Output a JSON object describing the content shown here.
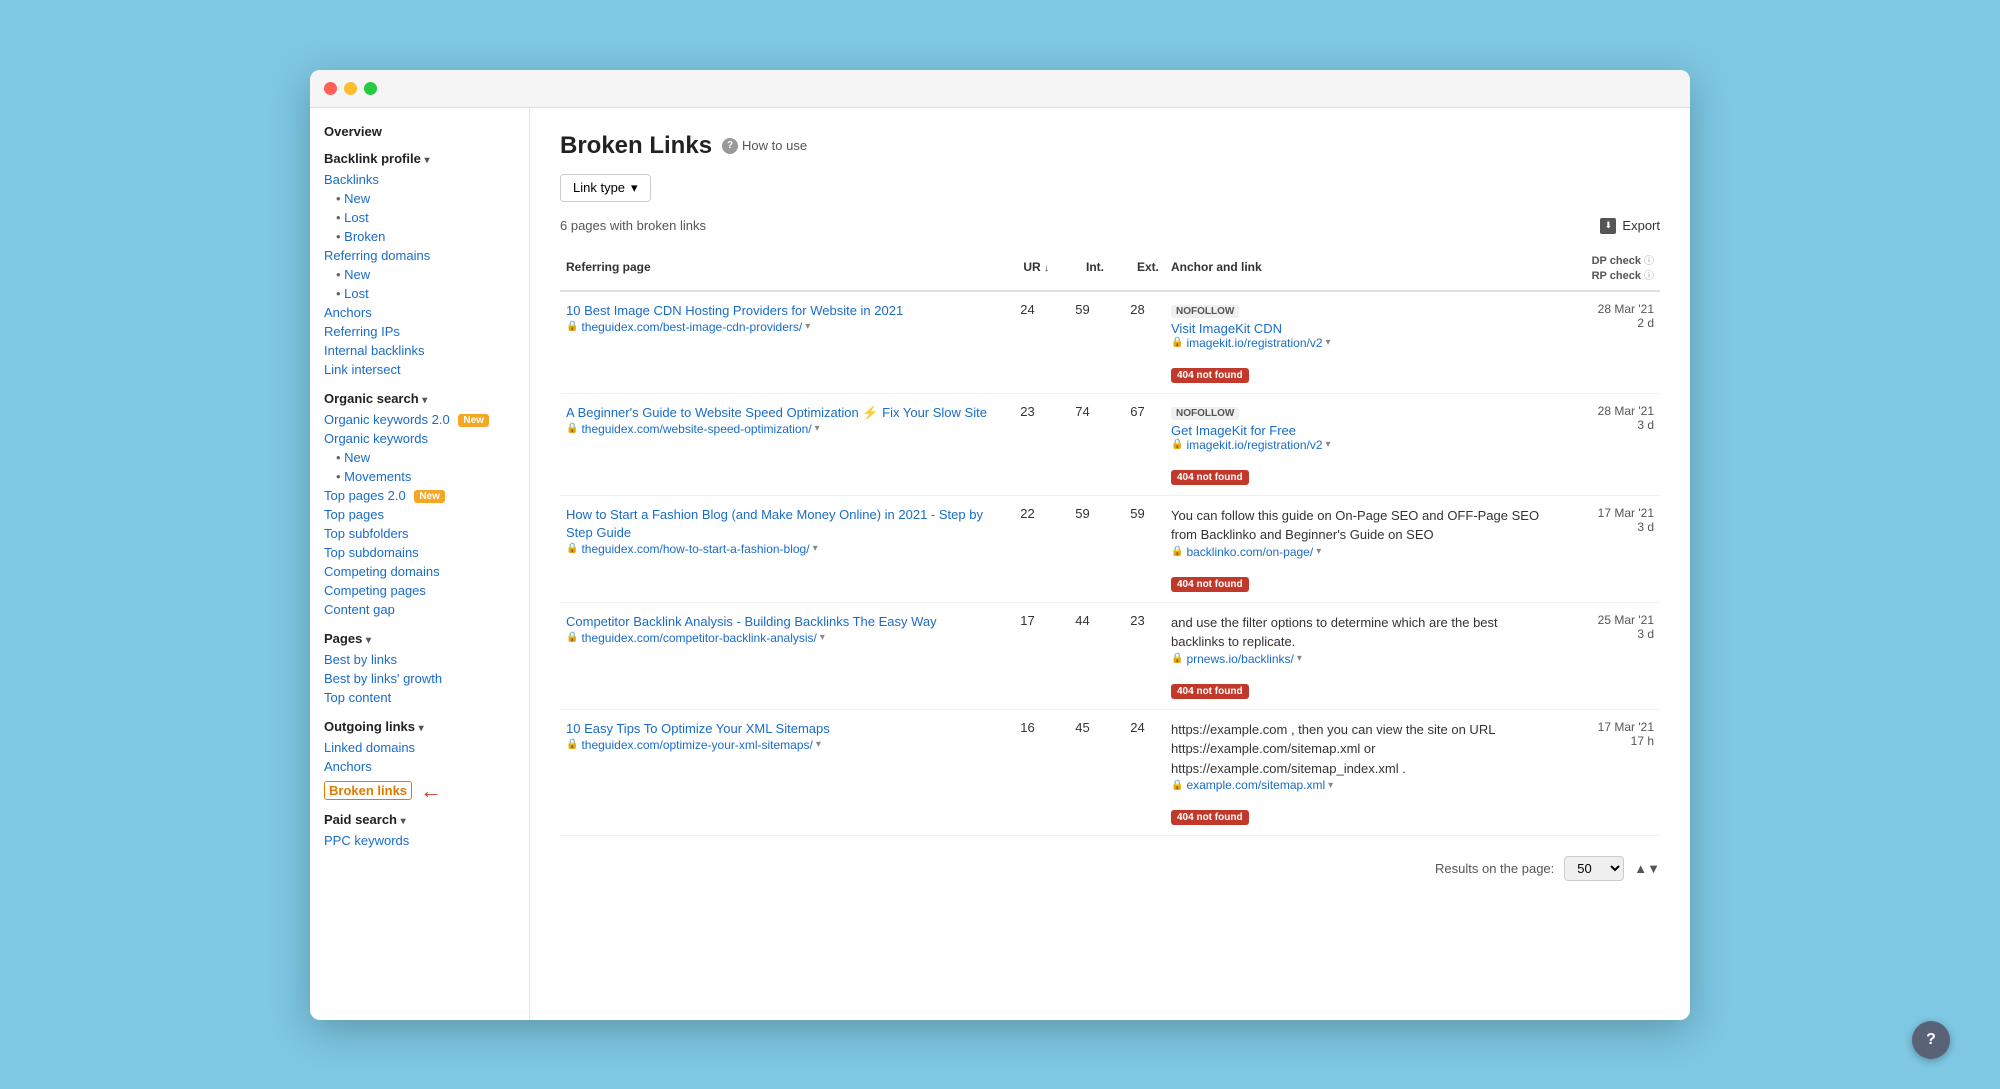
{
  "window": {
    "title": "Broken Links"
  },
  "titleBar": {
    "dots": [
      "red",
      "yellow",
      "green"
    ]
  },
  "sidebar": {
    "overview": "Overview",
    "backlink_profile": "Backlink profile",
    "backlinks": "Backlinks",
    "backlinks_new": "New",
    "backlinks_lost": "Lost",
    "backlinks_broken": "Broken",
    "referring_domains": "Referring domains",
    "referring_domains_new": "New",
    "referring_domains_lost": "Lost",
    "anchors": "Anchors",
    "referring_ips": "Referring IPs",
    "internal_backlinks": "Internal backlinks",
    "link_intersect": "Link intersect",
    "organic_search": "Organic search",
    "organic_keywords_2": "Organic keywords 2.0",
    "organic_keywords": "Organic keywords",
    "organic_keywords_new": "New",
    "organic_keywords_movements": "Movements",
    "top_pages_2": "Top pages 2.0",
    "top_pages": "Top pages",
    "top_subfolders": "Top subfolders",
    "top_subdomains": "Top subdomains",
    "competing_domains": "Competing domains",
    "competing_pages": "Competing pages",
    "content_gap": "Content gap",
    "pages": "Pages",
    "best_by_links": "Best by links",
    "best_by_links_growth": "Best by links' growth",
    "top_content": "Top content",
    "outgoing_links": "Outgoing links",
    "linked_domains": "Linked domains",
    "anchors_outgoing": "Anchors",
    "broken_links": "Broken links",
    "paid_search": "Paid search",
    "ppc_keywords": "PPC keywords",
    "badge_new": "New"
  },
  "page": {
    "title": "Broken Links",
    "how_to_use": "How to use",
    "filter_label": "Link type",
    "result_count": "6 pages with broken links",
    "export_label": "Export"
  },
  "table": {
    "headers": {
      "referring_page": "Referring page",
      "ur": "UR",
      "int": "Int.",
      "ext": "Ext.",
      "anchor_and_link": "Anchor and link",
      "dp_check": "DP check",
      "rp_check": "RP check"
    },
    "rows": [
      {
        "title": "10 Best Image CDN Hosting Providers for Website in 2021",
        "url": "theguidex.com/best-image-cdn-providers/",
        "ur": "24",
        "int": "59",
        "ext": "28",
        "nofollow": true,
        "anchor_text": "Visit ImageKit CDN",
        "broken_url": "imagekit.io/registration/v2",
        "dp_date": "28 Mar '21",
        "rp_date": "2 d"
      },
      {
        "title": "A Beginner's Guide to Website Speed Optimization ⚡ Fix Your Slow Site",
        "url": "theguidex.com/website-speed-optimization/",
        "ur": "23",
        "int": "74",
        "ext": "67",
        "nofollow": true,
        "anchor_text": "Get ImageKit for Free",
        "broken_url": "imagekit.io/registration/v2",
        "dp_date": "28 Mar '21",
        "rp_date": "3 d"
      },
      {
        "title": "How to Start a Fashion Blog (and Make Money Online) in 2021 - Step by Step Guide",
        "url": "theguidex.com/how-to-start-a-fashion-blog/",
        "ur": "22",
        "int": "59",
        "ext": "59",
        "nofollow": false,
        "inline_text": "You can follow this guide on On-Page SEO and OFF-Page SEO from Backlinko and Beginner's Guide on SEO",
        "broken_url": "backlinko.com/on-page/",
        "dp_date": "17 Mar '21",
        "rp_date": "3 d"
      },
      {
        "title": "Competitor Backlink Analysis - Building Backlinks The Easy Way",
        "url": "theguidex.com/competitor-backlink-analysis/",
        "ur": "17",
        "int": "44",
        "ext": "23",
        "nofollow": false,
        "inline_text": "and use the filter options to determine which are the best backlinks to replicate.",
        "broken_url": "prnews.io/backlinks/",
        "dp_date": "25 Mar '21",
        "rp_date": "3 d"
      },
      {
        "title": "10 Easy Tips To Optimize Your XML Sitemaps",
        "url": "theguidex.com/optimize-your-xml-sitemaps/",
        "ur": "16",
        "int": "45",
        "ext": "24",
        "nofollow": false,
        "inline_text": "https://example.com , then you can view the site on URL https://example.com/sitemap.xml or https://example.com/sitemap_index.xml .",
        "broken_url": "example.com/sitemap.xml",
        "dp_date": "17 Mar '21",
        "rp_date": "17 h"
      }
    ],
    "not_found_label": "404 not found",
    "nofollow_label": "NOFOLLOW"
  },
  "pagination": {
    "label": "Results on the page:",
    "value": "50"
  },
  "help": {
    "label": "?"
  }
}
